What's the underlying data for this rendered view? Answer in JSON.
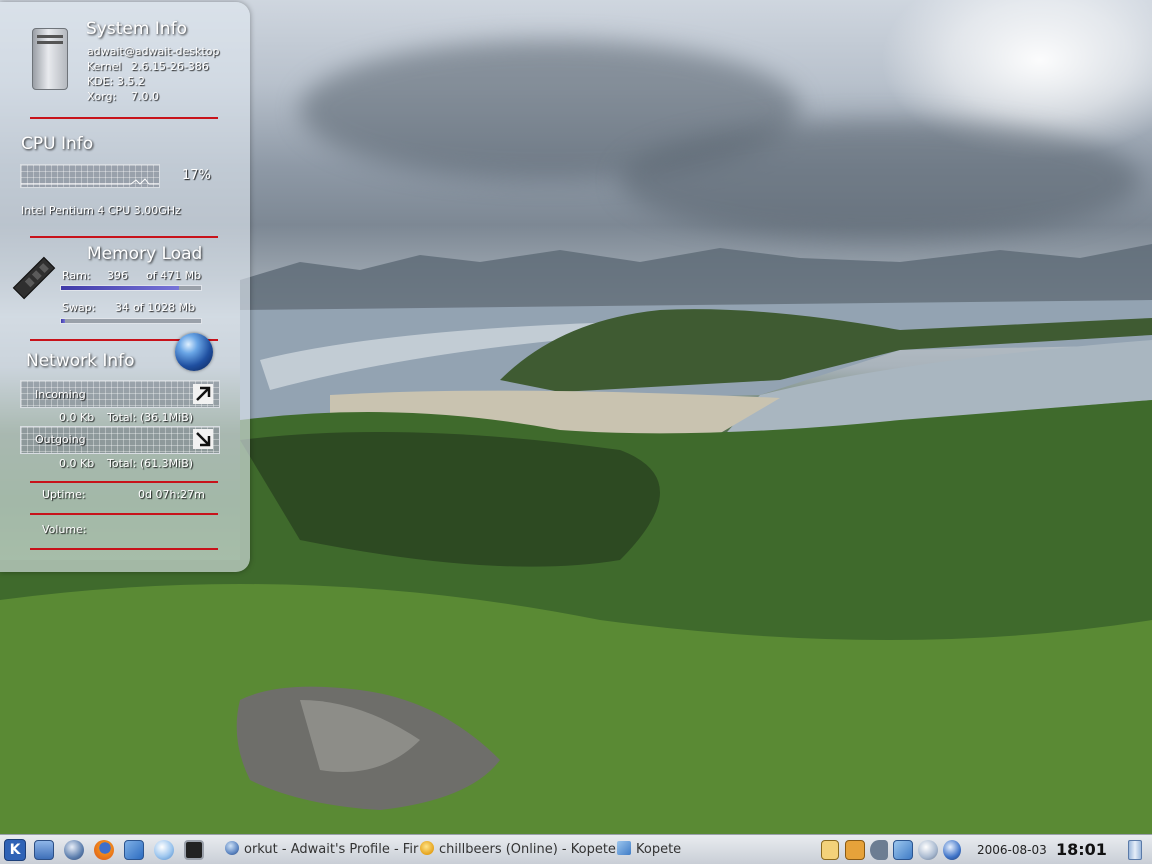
{
  "system": {
    "title": "System Info",
    "user_host": "adwait@adwait-desktop",
    "kernel_label": "Kernel",
    "kernel_value": "2.6.15-26-386",
    "kde_label": "KDE:",
    "kde_value": "3.5.2",
    "xorg_label": "Xorg:",
    "xorg_value": "7.0.0"
  },
  "cpu": {
    "title": "CPU Info",
    "usage": "17%",
    "model": "Intel Pentium 4 CPU 3.00GHz"
  },
  "memory": {
    "title": "Memory Load",
    "ram_label": "Ram:",
    "ram_used": "396",
    "ram_total": "of 471 Mb",
    "ram_fraction": 0.84,
    "swap_label": "Swap:",
    "swap_used": "34",
    "swap_total": "of 1028 Mb",
    "swap_fraction": 0.03
  },
  "network": {
    "title": "Network Info",
    "incoming_label": "Incoming",
    "incoming_rate": "0.0 Kb",
    "incoming_total": "Total:  (36.1MiB)",
    "outgoing_label": "Outgoing",
    "outgoing_rate": "0.0 Kb",
    "outgoing_total": "Total:  (61.3MiB)"
  },
  "uptime": {
    "label": "Uptime:",
    "value": "0d 07h:27m"
  },
  "volume": {
    "label": "Volume:"
  },
  "taskbar": {
    "tasks": [
      {
        "label": "orkut - Adwait's Profile - Fir",
        "icon": "orkut-globe-icon"
      },
      {
        "label": "chillbeers (Online) - Kopete",
        "icon": "kopete-icon"
      },
      {
        "label": "Kopete",
        "icon": "kopete-icon"
      }
    ],
    "date": "2006-08-03",
    "time": "18:01"
  },
  "colors": {
    "separator": "#c8121a",
    "kde_blue": "#2f63b6"
  }
}
